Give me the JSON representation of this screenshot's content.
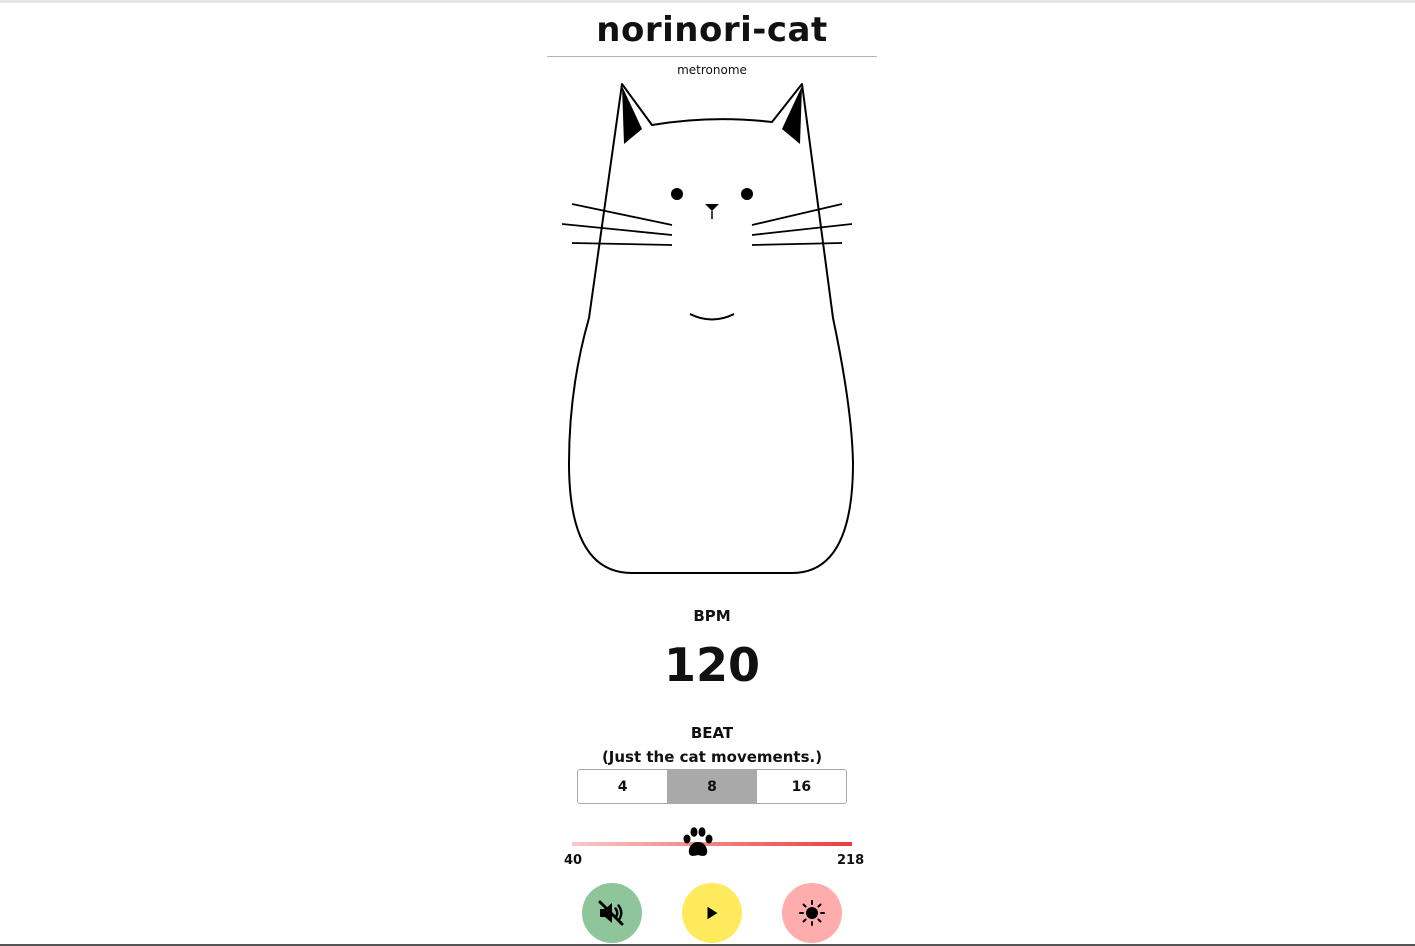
{
  "app": {
    "title": "norinori-cat",
    "subtitle": "metronome"
  },
  "bpm": {
    "label": "BPM",
    "value": "120",
    "min_label": "40",
    "max_label": "218",
    "level": 0.45
  },
  "beat": {
    "label": "BEAT",
    "note": "(Just the cat movements.)",
    "options": [
      "4",
      "8",
      "16"
    ],
    "selected": "8"
  },
  "controls": {
    "mute": {
      "icon": "speaker-muted-icon",
      "color": "#8fc59a"
    },
    "play": {
      "icon": "play-icon",
      "color": "#ffe95c"
    },
    "theme": {
      "icon": "sun-icon",
      "color": "#ffacac"
    }
  },
  "colors": {
    "slider_start": "#f7c9c9",
    "slider_end": "#ef3b3b",
    "beat_active": "#a9a9a9"
  }
}
